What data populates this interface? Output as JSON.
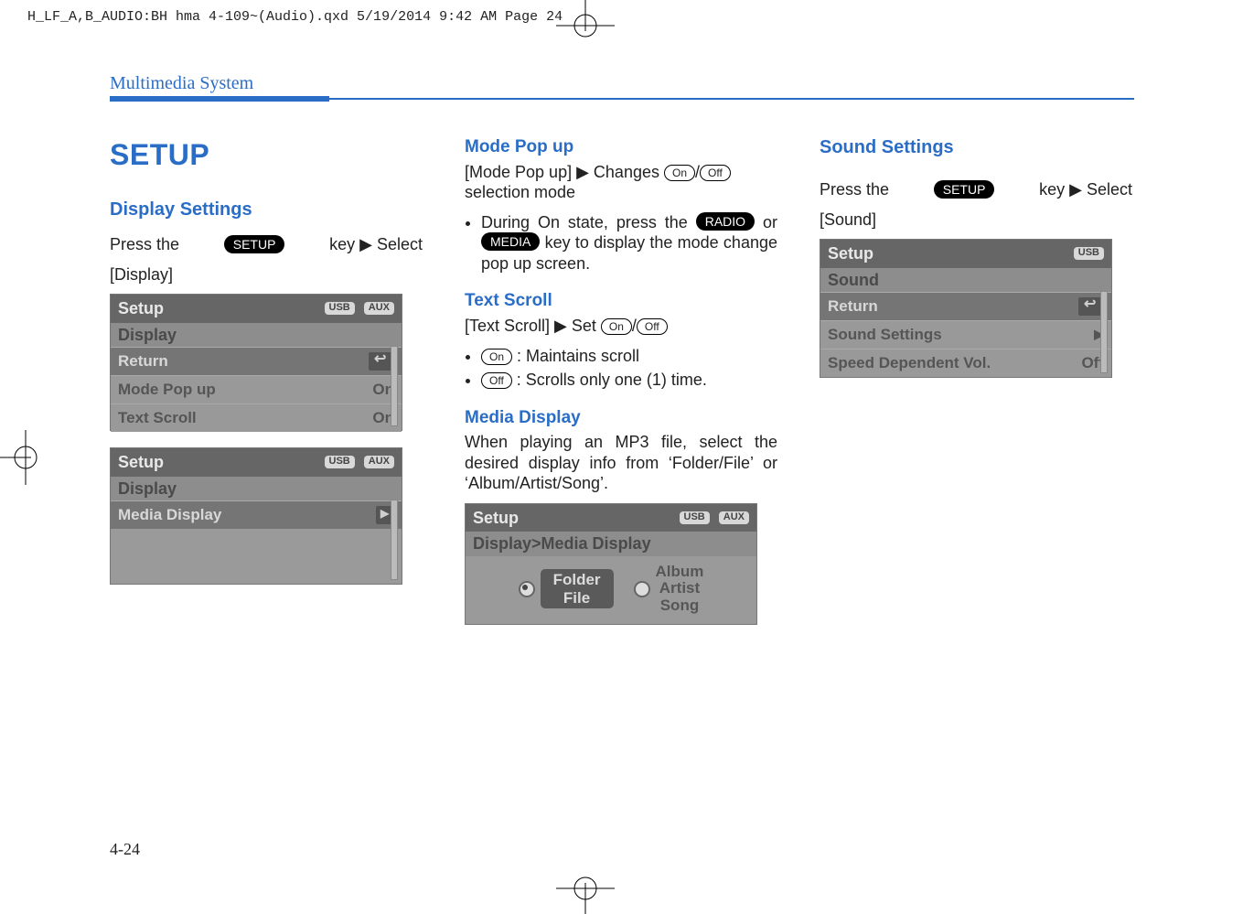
{
  "meta": {
    "crop_header": "H_LF_A,B_AUDIO:BH hma 4-109~(Audio).qxd  5/19/2014  9:42 AM  Page 24"
  },
  "running_head": "Multimedia System",
  "page_number": "4-24",
  "col1": {
    "h1": "SETUP",
    "h2": "Display Settings",
    "press_prefix": "Press  the",
    "setup_pill": "SETUP",
    "press_suffix": "key ▶ Select",
    "select_target": "[Display]",
    "shot1": {
      "title": "Setup",
      "tags": [
        "USB",
        "AUX"
      ],
      "sub": "Display",
      "rows": [
        {
          "label": "Return",
          "icon": "return"
        },
        {
          "label": "Mode Pop up",
          "val": "On"
        },
        {
          "label": "Text Scroll",
          "val": "On"
        }
      ]
    },
    "shot2": {
      "title": "Setup",
      "tags": [
        "USB",
        "AUX"
      ],
      "sub": "Display",
      "rows": [
        {
          "label": "Media Display",
          "icon": "arrow"
        }
      ]
    }
  },
  "col2": {
    "mode": {
      "h3": "Mode Pop up",
      "line1_prefix": "[Mode Pop up] ▶ Changes ",
      "btn_on": "On",
      "btn_off": "Off",
      "line1_suffix": "selection mode",
      "bullet_prefix": "During On state, press the ",
      "pill_radio": "RADIO",
      "bullet_mid": "or ",
      "pill_media": "MEDIA",
      "bullet_suffix": " key to display the mode change pop up screen."
    },
    "scroll": {
      "h3": "Text Scroll",
      "line_prefix": "[Text Scroll] ▶ Set ",
      "btn_on": "On",
      "btn_off": "Off",
      "b1_suffix": " : Maintains scroll",
      "b2_suffix": " : Scrolls only one (1) time."
    },
    "media": {
      "h3": "Media Display",
      "para": "When playing an MP3 file, select the desired display info from ‘Folder/File’ or ‘Album/Artist/Song’."
    },
    "shot_md": {
      "title": "Setup",
      "tags": [
        "USB",
        "AUX"
      ],
      "sub": "Display>Media Display",
      "opt1_l1": "Folder",
      "opt1_l2": "File",
      "opt2_l1": "Album",
      "opt2_l2": "Artist",
      "opt2_l3": "Song"
    }
  },
  "col3": {
    "h2": "Sound Settings",
    "press_prefix": "Press  the",
    "setup_pill": "SETUP",
    "press_suffix": "key ▶ Select",
    "select_target": "[Sound]",
    "shot": {
      "title": "Setup",
      "tags": [
        "USB"
      ],
      "sub": "Sound",
      "rows": [
        {
          "label": "Return",
          "icon": "return"
        },
        {
          "label": "Sound Settings",
          "icon": "arrow-plain"
        },
        {
          "label": "Speed Dependent Vol.",
          "val": "Off"
        }
      ]
    }
  }
}
